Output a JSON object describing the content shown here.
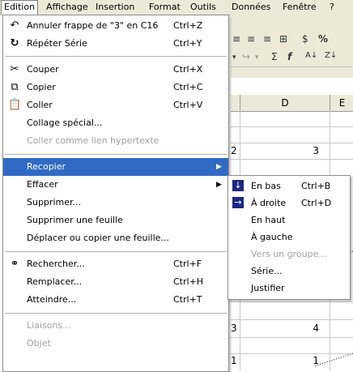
{
  "menubar": {
    "items": [
      {
        "label": "Edition"
      },
      {
        "label": "Affichage"
      },
      {
        "label": "Insertion"
      },
      {
        "label": "Format"
      },
      {
        "label": "Outils"
      },
      {
        "label": "Données"
      },
      {
        "label": "Fenêtre"
      },
      {
        "label": "?"
      }
    ]
  },
  "sheet": {
    "columns": [
      "D",
      "E"
    ],
    "cells": [
      {
        "value": "2"
      },
      {
        "value": "3"
      },
      {
        "value": "3"
      },
      {
        "value": "4"
      },
      {
        "value": "1"
      },
      {
        "value": "1"
      }
    ]
  },
  "edition_menu": {
    "items": [
      {
        "label": "Annuler frappe de \"3\" en C16",
        "shortcut": "Ctrl+Z",
        "icon": "undo-icon"
      },
      {
        "label": "Répéter Série",
        "shortcut": "Ctrl+Y",
        "icon": "redo-icon"
      },
      {
        "label": "Couper",
        "shortcut": "Ctrl+X",
        "icon": "scissors-icon"
      },
      {
        "label": "Copier",
        "shortcut": "Ctrl+C",
        "icon": "copy-icon"
      },
      {
        "label": "Coller",
        "shortcut": "Ctrl+V",
        "icon": "paste-icon"
      },
      {
        "label": "Collage spécial...",
        "shortcut": ""
      },
      {
        "label": "Coller comme lien hypertexte",
        "shortcut": ""
      },
      {
        "label": "Recopier",
        "shortcut": ""
      },
      {
        "label": "Effacer",
        "shortcut": ""
      },
      {
        "label": "Supprimer...",
        "shortcut": ""
      },
      {
        "label": "Supprimer une feuille",
        "shortcut": ""
      },
      {
        "label": "Déplacer ou copier une feuille...",
        "shortcut": ""
      },
      {
        "label": "Rechercher...",
        "shortcut": "Ctrl+F",
        "icon": "binoculars-icon"
      },
      {
        "label": "Remplacer...",
        "shortcut": "Ctrl+H"
      },
      {
        "label": "Atteindre...",
        "shortcut": "Ctrl+T"
      },
      {
        "label": "Liaisons...",
        "shortcut": ""
      },
      {
        "label": "Objet",
        "shortcut": ""
      }
    ]
  },
  "recopier_submenu": {
    "items": [
      {
        "label": "En bas",
        "shortcut": "Ctrl+B",
        "icon": "fill-down-icon"
      },
      {
        "label": "À droite",
        "shortcut": "Ctrl+D",
        "icon": "fill-right-icon"
      },
      {
        "label": "En haut",
        "shortcut": ""
      },
      {
        "label": "À gauche",
        "shortcut": ""
      },
      {
        "label": "Vers un groupe...",
        "shortcut": ""
      },
      {
        "label": "Série...",
        "shortcut": ""
      },
      {
        "label": "Justifier",
        "shortcut": ""
      }
    ]
  },
  "colors": {
    "highlight": "#316ac5",
    "menu_bg": "#ffffff",
    "bar_bg": "#ece9d8",
    "disabled_text": "#a0a0a0"
  }
}
